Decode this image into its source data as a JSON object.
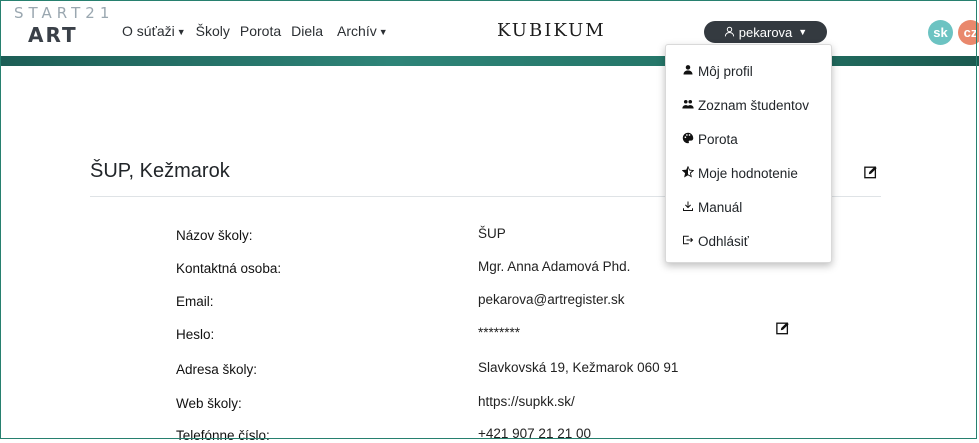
{
  "logo": {
    "top_text": "START21",
    "bottom_text": "ART"
  },
  "nav": {
    "items": [
      {
        "label": "O súťaži",
        "has_caret": true
      },
      {
        "label": "Školy",
        "has_caret": false
      },
      {
        "label": "Porota",
        "has_caret": false
      },
      {
        "label": "Diela",
        "has_caret": false
      },
      {
        "label": "Archív",
        "has_caret": true
      }
    ]
  },
  "brand": "KUBIKUM",
  "user": {
    "name": "pekarova",
    "icon": "user-icon"
  },
  "languages": [
    "sk",
    "cz"
  ],
  "dropdown": {
    "items": [
      {
        "label": "Môj profil",
        "icon": "user-icon"
      },
      {
        "label": "Zoznam študentov",
        "icon": "users-icon"
      },
      {
        "label": "Porota",
        "icon": "palette-icon"
      },
      {
        "label": "Moje hodnotenie",
        "icon": "star-half-icon"
      },
      {
        "label": "Manuál",
        "icon": "download-icon"
      },
      {
        "label": "Odhlásiť",
        "icon": "logout-icon"
      }
    ]
  },
  "school": {
    "title": "ŠUP, Kežmarok",
    "fields": [
      {
        "label": "Názov školy:",
        "value": "ŠUP"
      },
      {
        "label": "Kontaktná osoba:",
        "value": "Mgr. Anna Adamová Phd."
      },
      {
        "label": "Email:",
        "value": "pekarova@artregister.sk"
      },
      {
        "label": "Heslo:",
        "value": "********"
      },
      {
        "label": "Adresa školy:",
        "value": "Slavkovská 19, Kežmarok 060 91"
      },
      {
        "label": "Web školy:",
        "value": "https://supkk.sk/"
      },
      {
        "label": "Telefónne číslo:",
        "value": "+421 907 21 21 00"
      }
    ]
  },
  "colors": {
    "accent": "#2e8478",
    "user_button": "#343a40",
    "lang_sk": "#6cc3c2",
    "lang_cz": "#e9886c"
  }
}
